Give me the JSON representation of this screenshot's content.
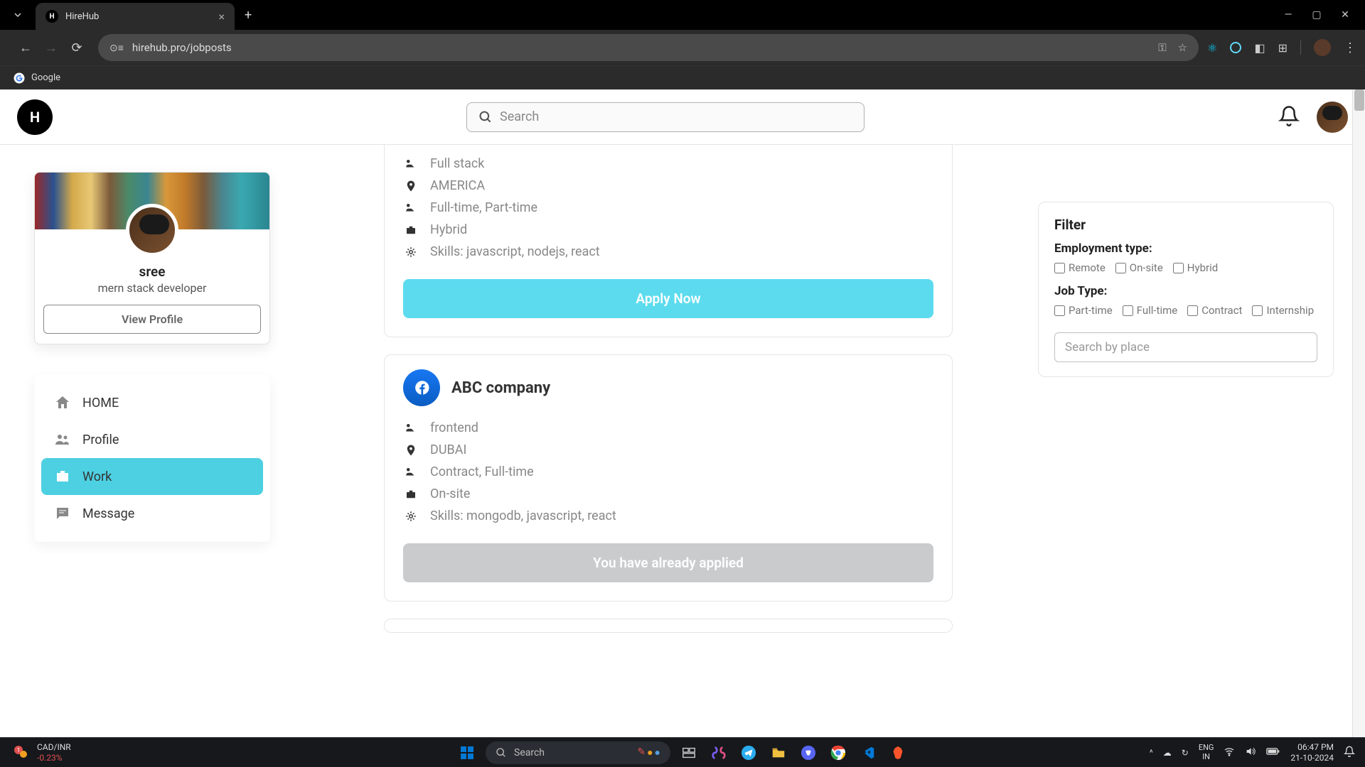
{
  "browser": {
    "tab_title": "HireHub",
    "url": "hirehub.pro/jobposts",
    "bookmarks": [
      {
        "label": "Google"
      }
    ]
  },
  "app": {
    "logo_letter": "H",
    "search_placeholder": "Search"
  },
  "profile": {
    "name": "sree",
    "role": "mern stack developer",
    "view_button": "View Profile"
  },
  "nav": {
    "items": [
      {
        "label": "HOME",
        "active": false
      },
      {
        "label": "Profile",
        "active": false
      },
      {
        "label": "Work",
        "active": true
      },
      {
        "label": "Message",
        "active": false
      }
    ]
  },
  "jobs": [
    {
      "role": "Full stack",
      "location": "AMERICA",
      "employment": "Full-time, Part-time",
      "mode": "Hybrid",
      "skills": "Skills: javascript, nodejs, react",
      "button": "Apply Now",
      "applied": false
    },
    {
      "company": "ABC company",
      "role": "frontend",
      "location": "DUBAI",
      "employment": "Contract, Full-time",
      "mode": "On-site",
      "skills": "Skills: mongodb, javascript, react",
      "button": "You have already applied",
      "applied": true
    }
  ],
  "filter": {
    "title": "Filter",
    "employment_label": "Employment type:",
    "employment_options": [
      "Remote",
      "On-site",
      "Hybrid"
    ],
    "jobtype_label": "Job Type:",
    "jobtype_options": [
      "Part-time",
      "Full-time",
      "Contract",
      "Internship"
    ],
    "place_placeholder": "Search by place"
  },
  "taskbar": {
    "widget": {
      "line1": "CAD/INR",
      "line2": "-0.23%",
      "badge": "1"
    },
    "search_placeholder": "Search",
    "lang": {
      "line1": "ENG",
      "line2": "IN"
    },
    "time": {
      "line1": "06:47 PM",
      "line2": "21-10-2024"
    }
  }
}
